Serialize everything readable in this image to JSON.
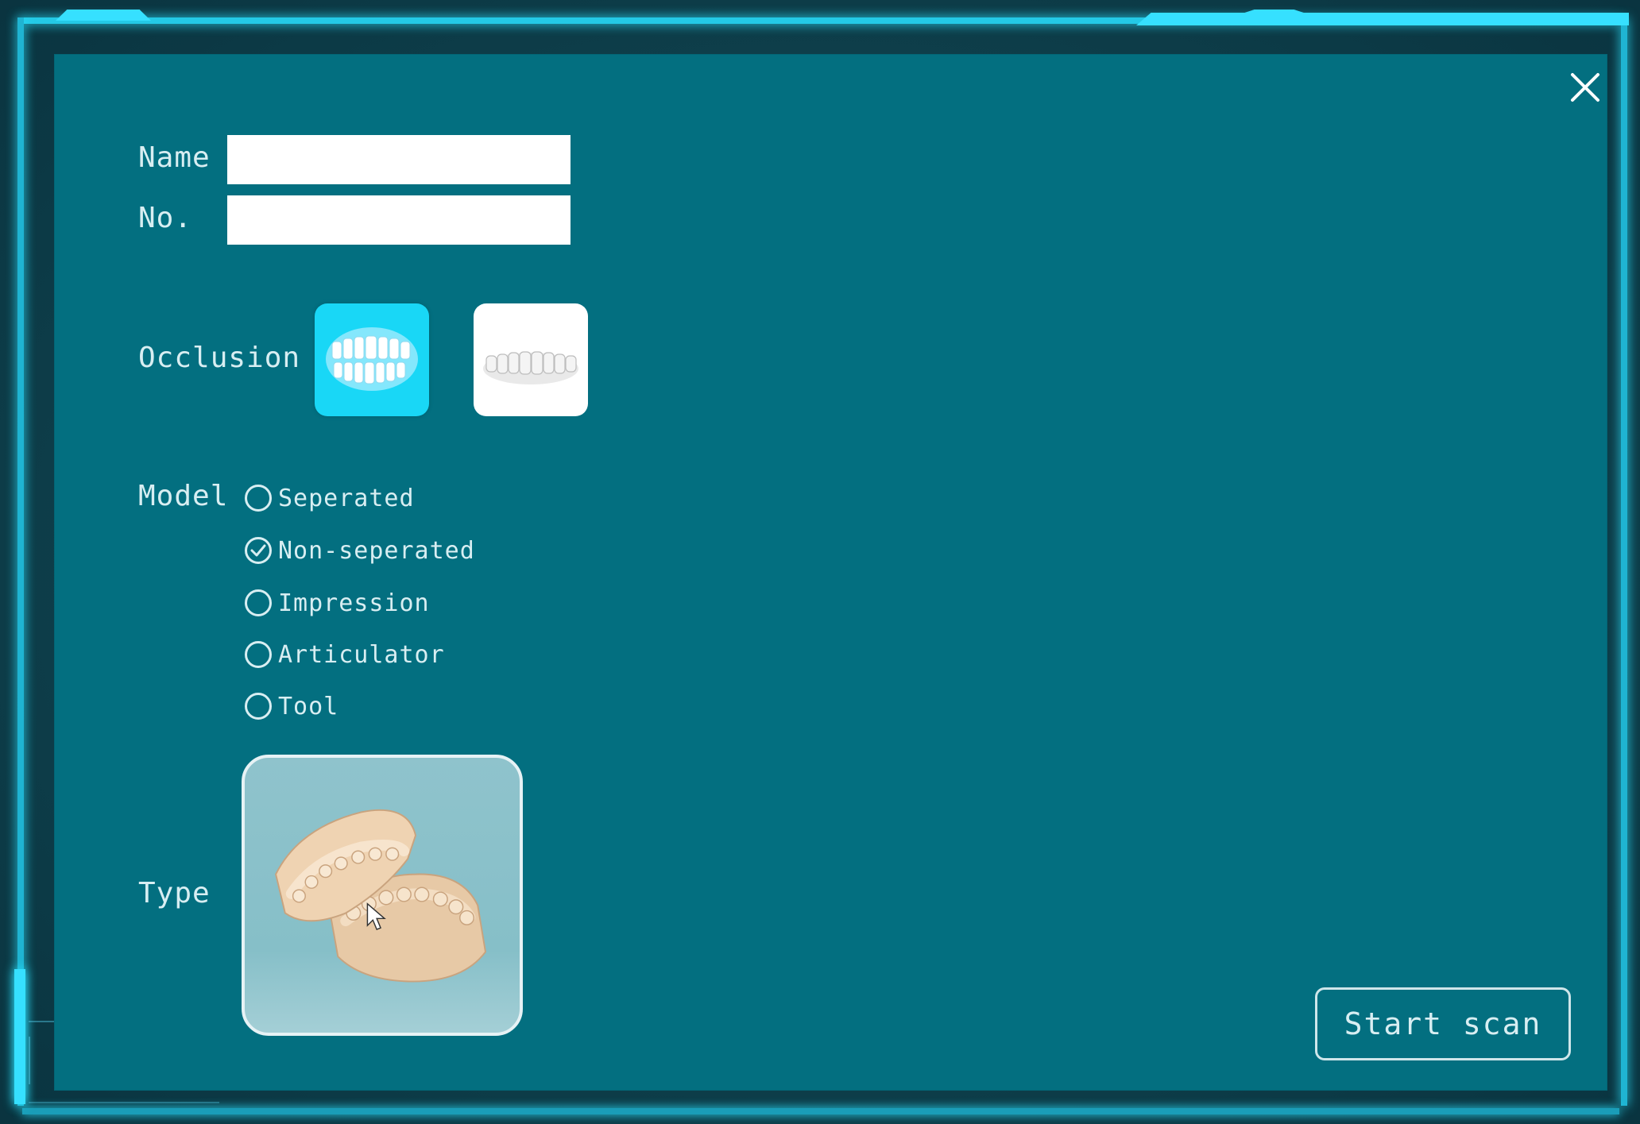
{
  "dialog": {
    "fields": {
      "name_label": "Name",
      "name_value": "",
      "no_label": "No.",
      "no_value": ""
    },
    "occlusion": {
      "label": "Occlusion",
      "options": [
        {
          "icon": "full-arch-teeth-icon",
          "selected": true
        },
        {
          "icon": "single-arch-teeth-icon",
          "selected": false
        }
      ]
    },
    "model": {
      "label": "Model",
      "options": [
        {
          "label": "Seperated",
          "selected": false
        },
        {
          "label": "Non-seperated",
          "selected": true
        },
        {
          "label": "Impression",
          "selected": false
        },
        {
          "label": "Articulator",
          "selected": false
        },
        {
          "label": "Tool",
          "selected": false
        }
      ]
    },
    "type": {
      "label": "Type",
      "image": "dental-model-image"
    },
    "start_button_label": "Start scan",
    "close_icon": "close-icon"
  },
  "colors": {
    "dialog_background": "#036f80",
    "frame_glow": "#36e0ff",
    "selected_tile": "#19d7f6",
    "text": "#d8eef2"
  }
}
